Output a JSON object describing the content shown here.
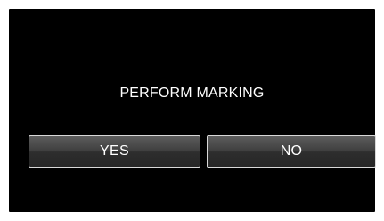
{
  "dialog": {
    "message": "PERFORM MARKING",
    "yes_label": "YES",
    "no_label": "NO"
  },
  "colors": {
    "background": "#000000",
    "text": "#ffffff",
    "button_border": "#d8d8d8"
  }
}
